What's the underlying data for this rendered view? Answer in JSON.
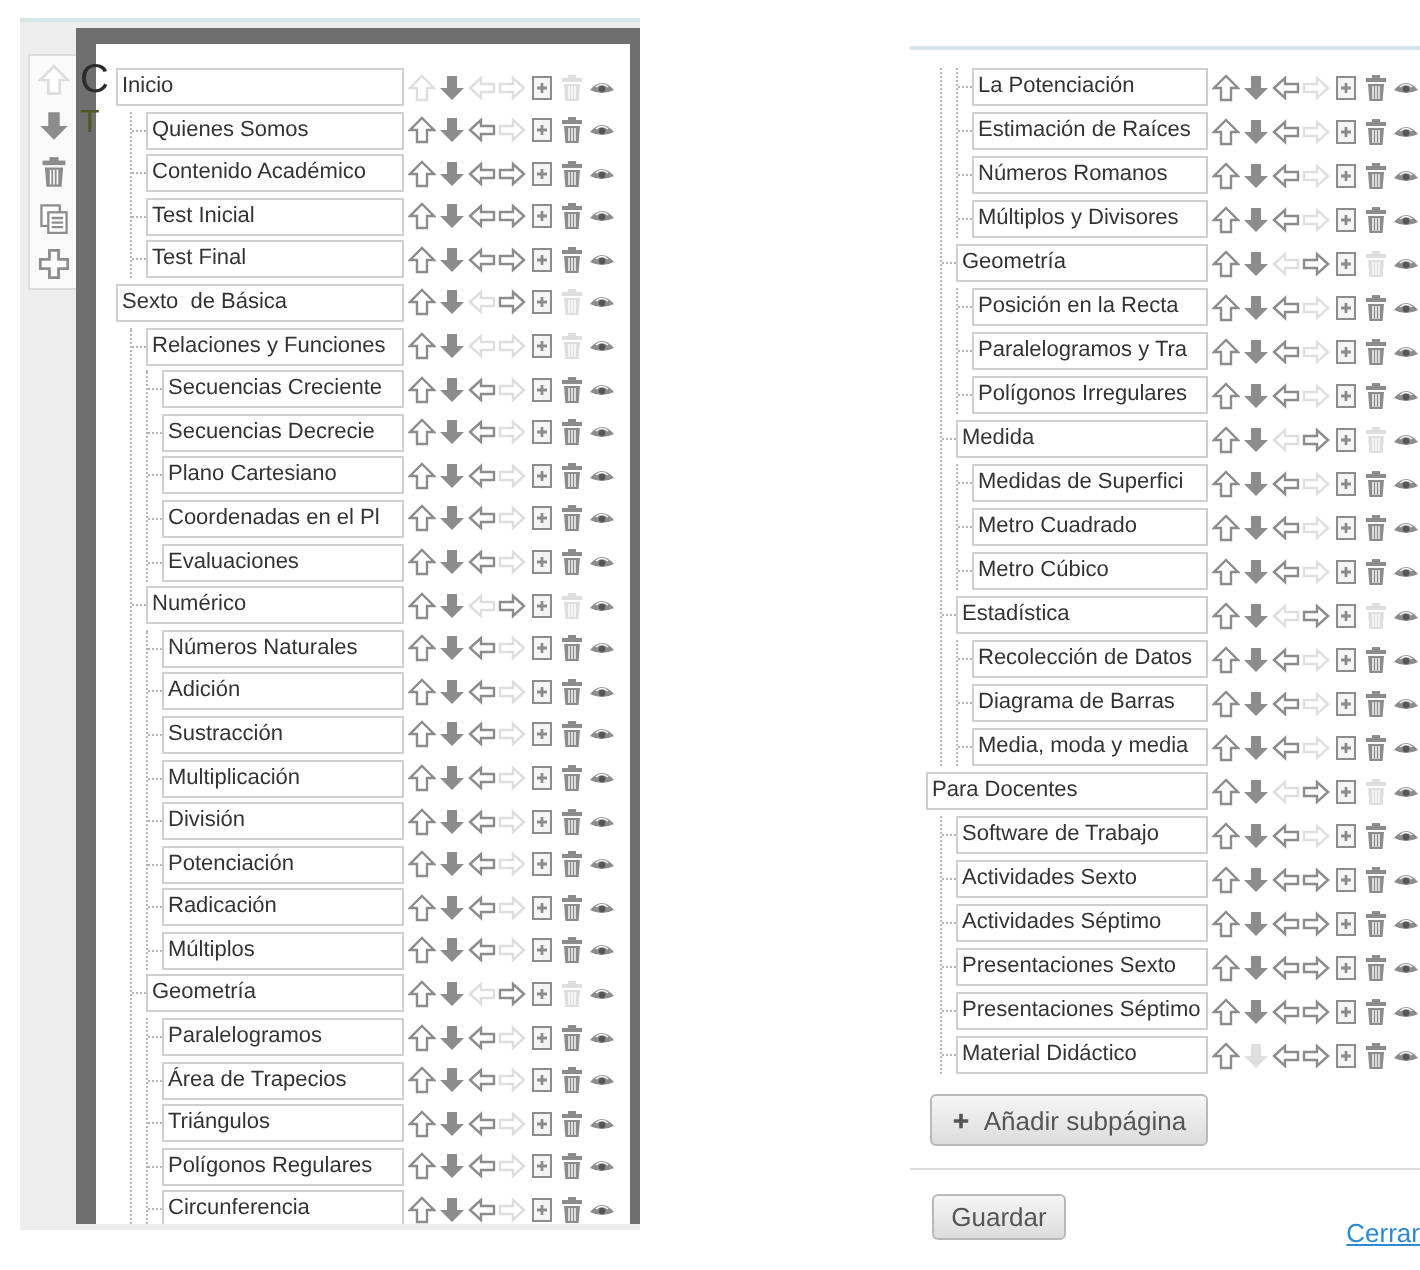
{
  "left_view": {
    "backdrop_texts": [
      "C",
      "T"
    ],
    "side_toolbar": [
      {
        "kind": "up",
        "enabled": false
      },
      {
        "kind": "down",
        "enabled": true
      },
      {
        "kind": "trash",
        "enabled": true
      },
      {
        "kind": "copy",
        "enabled": true
      },
      {
        "kind": "plus",
        "enabled": true
      }
    ],
    "tree": [
      {
        "label": "Inicio",
        "up": false,
        "down": true,
        "left": false,
        "right": false,
        "delete": false,
        "children": [
          {
            "label": "Quienes Somos",
            "up": true,
            "down": true,
            "left": true,
            "right": false,
            "delete": true
          },
          {
            "label": "Contenido Académico",
            "up": true,
            "down": true,
            "left": true,
            "right": true,
            "delete": true
          },
          {
            "label": "Test Inicial",
            "up": true,
            "down": true,
            "left": true,
            "right": true,
            "delete": true
          },
          {
            "label": "Test Final",
            "up": true,
            "down": true,
            "left": true,
            "right": true,
            "delete": true
          }
        ]
      },
      {
        "label": "Sexto  de Básica",
        "up": true,
        "down": true,
        "left": false,
        "right": true,
        "delete": false,
        "children": [
          {
            "label": "Relaciones y Funciones",
            "up": true,
            "down": true,
            "left": false,
            "right": false,
            "delete": false,
            "children": [
              {
                "label": "Secuencias Creciente",
                "up": true,
                "down": true,
                "left": true,
                "right": false,
                "delete": true
              },
              {
                "label": "Secuencias Decrecie",
                "up": true,
                "down": true,
                "left": true,
                "right": false,
                "delete": true
              },
              {
                "label": "Plano Cartesiano",
                "up": true,
                "down": true,
                "left": true,
                "right": false,
                "delete": true
              },
              {
                "label": "Coordenadas en el Pl",
                "up": true,
                "down": true,
                "left": true,
                "right": false,
                "delete": true
              },
              {
                "label": "Evaluaciones",
                "up": true,
                "down": true,
                "left": true,
                "right": false,
                "delete": true
              }
            ]
          },
          {
            "label": "Numérico",
            "up": true,
            "down": true,
            "left": false,
            "right": true,
            "delete": false,
            "children": [
              {
                "label": "Números Naturales",
                "up": true,
                "down": true,
                "left": true,
                "right": false,
                "delete": true
              },
              {
                "label": "Adición",
                "up": true,
                "down": true,
                "left": true,
                "right": false,
                "delete": true
              },
              {
                "label": "Sustracción",
                "up": true,
                "down": true,
                "left": true,
                "right": false,
                "delete": true
              },
              {
                "label": "Multiplicación",
                "up": true,
                "down": true,
                "left": true,
                "right": false,
                "delete": true
              },
              {
                "label": "División",
                "up": true,
                "down": true,
                "left": true,
                "right": false,
                "delete": true
              },
              {
                "label": "Potenciación",
                "up": true,
                "down": true,
                "left": true,
                "right": false,
                "delete": true
              },
              {
                "label": "Radicación",
                "up": true,
                "down": true,
                "left": true,
                "right": false,
                "delete": true
              },
              {
                "label": "Múltiplos",
                "up": true,
                "down": true,
                "left": true,
                "right": false,
                "delete": true
              }
            ]
          },
          {
            "label": "Geometría",
            "up": true,
            "down": true,
            "left": false,
            "right": true,
            "delete": false,
            "children": [
              {
                "label": "Paralelogramos",
                "up": true,
                "down": true,
                "left": true,
                "right": false,
                "delete": true
              },
              {
                "label": "Área de Trapecios",
                "up": true,
                "down": true,
                "left": true,
                "right": false,
                "delete": true
              },
              {
                "label": "Triángulos",
                "up": true,
                "down": true,
                "left": true,
                "right": false,
                "delete": true
              },
              {
                "label": "Polígonos Regulares",
                "up": true,
                "down": true,
                "left": true,
                "right": false,
                "delete": true
              },
              {
                "label": "Circunferencia",
                "up": true,
                "down": true,
                "left": true,
                "right": false,
                "delete": true
              }
            ]
          }
        ]
      }
    ]
  },
  "right_view": {
    "tree": [
      {
        "children": [
          {
            "children": [
              {
                "label": "La Potenciación",
                "up": true,
                "down": true,
                "left": true,
                "right": false,
                "delete": true
              },
              {
                "label": "Estimación de Raíces",
                "up": true,
                "down": true,
                "left": true,
                "right": false,
                "delete": true
              },
              {
                "label": "Números Romanos",
                "up": true,
                "down": true,
                "left": true,
                "right": false,
                "delete": true
              },
              {
                "label": "Múltiplos y Divisores",
                "up": true,
                "down": true,
                "left": true,
                "right": false,
                "delete": true
              }
            ]
          },
          {
            "label": "Geometría",
            "up": true,
            "down": true,
            "left": false,
            "right": true,
            "delete": false,
            "children": [
              {
                "label": "Posición en la Recta",
                "up": true,
                "down": true,
                "left": true,
                "right": false,
                "delete": true
              },
              {
                "label": "Paralelogramos y Tra",
                "up": true,
                "down": true,
                "left": true,
                "right": false,
                "delete": true
              },
              {
                "label": "Polígonos Irregulares",
                "up": true,
                "down": true,
                "left": true,
                "right": false,
                "delete": true
              }
            ]
          },
          {
            "label": "Medida",
            "up": true,
            "down": true,
            "left": false,
            "right": true,
            "delete": false,
            "children": [
              {
                "label": "Medidas de Superfici",
                "up": true,
                "down": true,
                "left": true,
                "right": false,
                "delete": true
              },
              {
                "label": "Metro Cuadrado",
                "up": true,
                "down": true,
                "left": true,
                "right": false,
                "delete": true
              },
              {
                "label": "Metro Cúbico",
                "up": true,
                "down": true,
                "left": true,
                "right": false,
                "delete": true
              }
            ]
          },
          {
            "label": "Estadística",
            "up": true,
            "down": true,
            "left": false,
            "right": true,
            "delete": false,
            "children": [
              {
                "label": "Recolección de Datos",
                "up": true,
                "down": true,
                "left": true,
                "right": false,
                "delete": true
              },
              {
                "label": "Diagrama de Barras",
                "up": true,
                "down": true,
                "left": true,
                "right": false,
                "delete": true
              },
              {
                "label": "Media, moda y media",
                "up": true,
                "down": true,
                "left": true,
                "right": false,
                "delete": true
              }
            ]
          }
        ]
      },
      {
        "label": "Para Docentes",
        "up": true,
        "down": true,
        "left": false,
        "right": true,
        "delete": false,
        "children": [
          {
            "label": "Software de Trabajo",
            "up": true,
            "down": true,
            "left": true,
            "right": false,
            "delete": true
          },
          {
            "label": "Actividades Sexto",
            "up": true,
            "down": true,
            "left": true,
            "right": true,
            "delete": true
          },
          {
            "label": "Actividades Séptimo",
            "up": true,
            "down": true,
            "left": true,
            "right": true,
            "delete": true
          },
          {
            "label": "Presentaciones Sexto",
            "up": true,
            "down": true,
            "left": true,
            "right": true,
            "delete": true
          },
          {
            "label": "Presentaciones Séptimo",
            "up": true,
            "down": true,
            "left": true,
            "right": true,
            "delete": true
          },
          {
            "label": "Material Didáctico",
            "up": true,
            "down": false,
            "left": true,
            "right": true,
            "delete": true
          }
        ]
      }
    ],
    "add_button": "Añadir subpágina",
    "save_button": "Guardar",
    "close_link": "Cerrar"
  }
}
